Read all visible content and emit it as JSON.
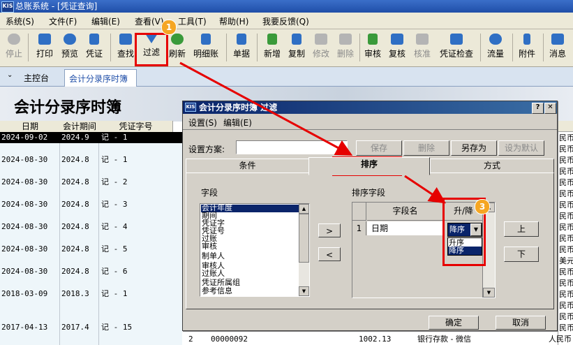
{
  "window": {
    "logo": "KIS",
    "title": "总账系统 - [凭证查询]"
  },
  "menu": [
    "系统(S)",
    "文件(F)",
    "编辑(E)",
    "查看(V)",
    "工具(T)",
    "帮助(H)",
    "我要反馈(Q)"
  ],
  "toolbar": [
    {
      "label": "停止",
      "icon": "stop-icon",
      "enabled": false,
      "color": "#606060"
    },
    {
      "label": "打印",
      "icon": "print-icon",
      "enabled": true,
      "color": "#2f6fc4"
    },
    {
      "label": "预览",
      "icon": "preview-icon",
      "enabled": true,
      "color": "#2f6fc4"
    },
    {
      "label": "凭证",
      "icon": "voucher-icon",
      "enabled": true,
      "color": "#2f6fc4"
    },
    {
      "label": "查找",
      "icon": "find-icon",
      "enabled": true,
      "color": "#2f6fc4"
    },
    {
      "label": "过滤",
      "icon": "filter-icon",
      "enabled": true,
      "color": "#2f6fc4"
    },
    {
      "label": "刷新",
      "icon": "refresh-icon",
      "enabled": true,
      "color": "#3a9a3a"
    },
    {
      "label": "明细账",
      "icon": "ledger-icon",
      "enabled": true,
      "color": "#2f6fc4"
    },
    {
      "label": "单据",
      "icon": "document-icon",
      "enabled": true,
      "color": "#2f6fc4"
    },
    {
      "label": "新增",
      "icon": "add-icon",
      "enabled": true,
      "color": "#3a9a3a"
    },
    {
      "label": "复制",
      "icon": "copy-icon",
      "enabled": true,
      "color": "#2f6fc4"
    },
    {
      "label": "修改",
      "icon": "edit-icon",
      "enabled": false,
      "color": "#606060"
    },
    {
      "label": "删除",
      "icon": "delete-icon",
      "enabled": false,
      "color": "#606060"
    },
    {
      "label": "审核",
      "icon": "audit-icon",
      "enabled": true,
      "color": "#3a9a3a"
    },
    {
      "label": "复核",
      "icon": "recheck-icon",
      "enabled": true,
      "color": "#2f6fc4"
    },
    {
      "label": "核准",
      "icon": "approve-icon",
      "enabled": false,
      "color": "#606060"
    },
    {
      "label": "凭证检查",
      "icon": "voucher-check-icon",
      "enabled": true,
      "color": "#2f6fc4"
    },
    {
      "label": "流量",
      "icon": "flow-icon",
      "enabled": true,
      "color": "#2f6fc4"
    },
    {
      "label": "附件",
      "icon": "attachment-icon",
      "enabled": true,
      "color": "#2f6fc4"
    },
    {
      "label": "消息",
      "icon": "message-icon",
      "enabled": true,
      "color": "#2f6fc4"
    }
  ],
  "tabs": {
    "home": "主控台",
    "current": "会计分录序时簿"
  },
  "page_title": "会计分录序时簿",
  "table": {
    "headers": [
      "日期",
      "会计期间",
      "凭证字号"
    ],
    "rows": [
      {
        "date": "2024-09-02",
        "period": "2024.9",
        "voucher": "记 - 1"
      },
      {
        "date": "2024-08-30",
        "period": "2024.8",
        "voucher": "记 - 1"
      },
      {
        "date": "2024-08-30",
        "period": "2024.8",
        "voucher": "记 - 2"
      },
      {
        "date": "2024-08-30",
        "period": "2024.8",
        "voucher": "记 - 3"
      },
      {
        "date": "2024-08-30",
        "period": "2024.8",
        "voucher": "记 - 4"
      },
      {
        "date": "2024-08-30",
        "period": "2024.8",
        "voucher": "记 - 5"
      },
      {
        "date": "2024-08-30",
        "period": "2024.8",
        "voucher": "记 - 6"
      },
      {
        "date": "2018-03-09",
        "period": "2018.3",
        "voucher": "记 - 1"
      },
      {
        "date": "2017-04-13",
        "period": "2017.4",
        "voucher": "记 - 15"
      }
    ],
    "right_column": [
      "民币",
      "民币",
      "民币",
      "民币",
      "民币",
      "民币",
      "民币",
      "民币",
      "民币",
      "民币",
      "民币",
      "美元",
      "民币",
      "民币",
      "民币",
      "民币",
      "民币",
      "民币",
      "人民币"
    ],
    "bottom_row": {
      "num": "2",
      "code": "00000092",
      "amount": "1002.13",
      "desc": "银行存款 - 微信"
    }
  },
  "dialog": {
    "logo": "KIS",
    "title": "会计分录序时簿 过滤",
    "menu": [
      "设置(S)",
      "编辑(E)"
    ],
    "scheme_label": "设置方案:",
    "scheme_value": "",
    "buttons": {
      "save": "保存",
      "delete": "删除",
      "save_as": "另存为",
      "set_default": "设为默认",
      "ok": "确定",
      "cancel": "取消",
      "up": "上",
      "down": "下",
      "move_right": ">",
      "move_left": "<"
    },
    "tabs": [
      "条件",
      "排序",
      "方式"
    ],
    "fields_label": "字段",
    "fields": [
      "会计年度",
      "期间",
      "凭证字",
      "凭证号",
      "过账",
      "审核",
      "制单人",
      "审核人",
      "过账人",
      "凭证所属组",
      "参考信息"
    ],
    "sort_label": "排序字段",
    "sort_headers": [
      "字段名",
      "升/降"
    ],
    "sort_rows": [
      {
        "num": "1",
        "field": "日期",
        "order": "降序"
      }
    ],
    "order_options": [
      "升序",
      "降序"
    ]
  },
  "annotations": [
    "1",
    "2",
    "3"
  ]
}
